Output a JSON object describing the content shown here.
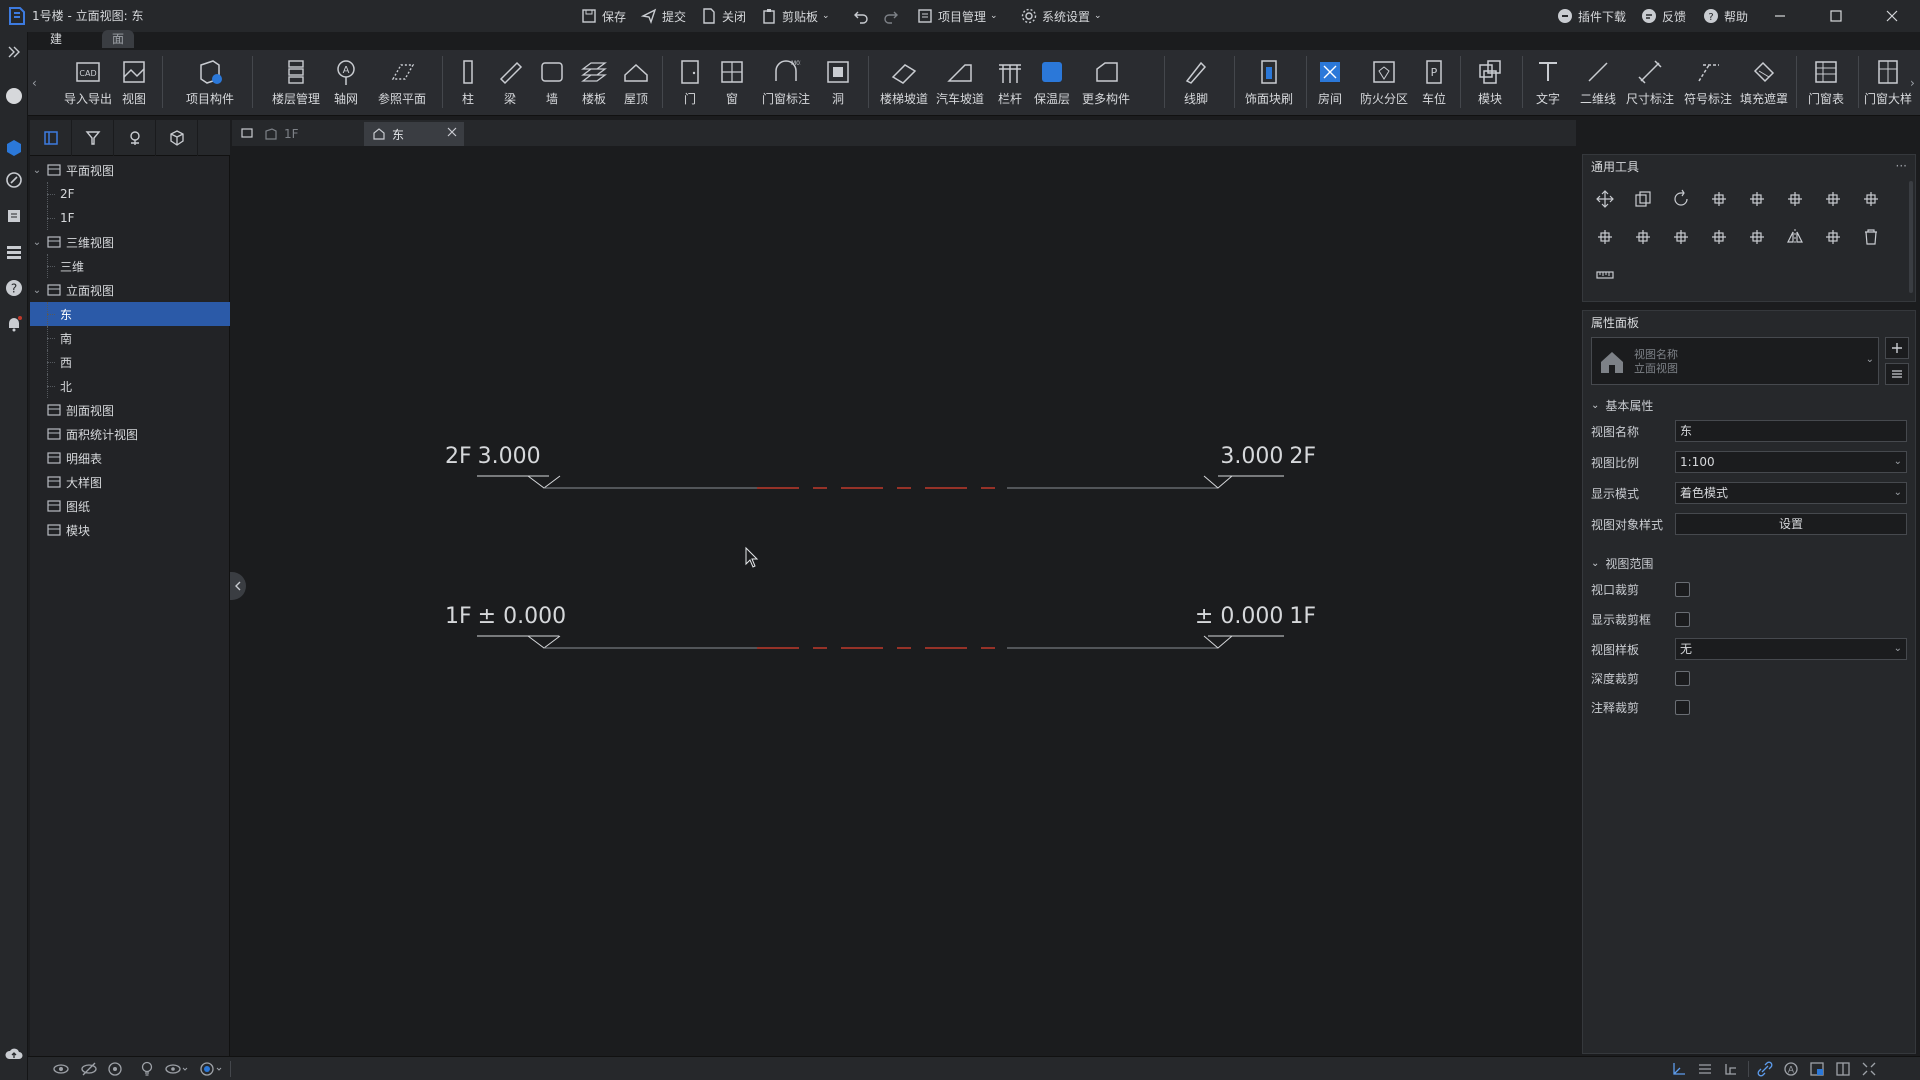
{
  "window": {
    "title": "1号楼 - 立面视图: 东",
    "toolbar": {
      "save": "保存",
      "submit": "提交",
      "close": "关闭",
      "clipboard": "剪贴板",
      "project_manage": "项目管理",
      "system_settings": "系统设置",
      "plugin_download": "插件下载",
      "feedback": "反馈",
      "help": "帮助"
    }
  },
  "ribbon": {
    "tabs": [
      "建筑",
      "面积统计"
    ],
    "buttons": [
      "导入导出",
      "视图",
      "项目构件",
      "楼层管理",
      "轴网",
      "参照平面",
      "柱",
      "梁",
      "墙",
      "楼板",
      "屋顶",
      "门",
      "窗",
      "门窗标注",
      "洞",
      "楼梯坡道",
      "汽车坡道",
      "栏杆",
      "保温层",
      "更多构件",
      "线脚",
      "饰面块刷",
      "房间",
      "防火分区",
      "车位",
      "模块",
      "文字",
      "二维线",
      "尺寸标注",
      "符号标注",
      "填充遮罩",
      "门窗表",
      "门窗大样"
    ]
  },
  "tree": {
    "nodes": [
      {
        "label": "平面视图",
        "level": 0,
        "expanded": true
      },
      {
        "label": "2F",
        "level": 1
      },
      {
        "label": "1F",
        "level": 1
      },
      {
        "label": "三维视图",
        "level": 0,
        "expanded": true
      },
      {
        "label": "三维",
        "level": 1
      },
      {
        "label": "立面视图",
        "level": 0,
        "expanded": true
      },
      {
        "label": "东",
        "level": 1,
        "selected": true
      },
      {
        "label": "南",
        "level": 1
      },
      {
        "label": "西",
        "level": 1
      },
      {
        "label": "北",
        "level": 1
      },
      {
        "label": "剖面视图",
        "level": 0
      },
      {
        "label": "面积统计视图",
        "level": 0
      },
      {
        "label": "明细表",
        "level": 0
      },
      {
        "label": "大样图",
        "level": 0
      },
      {
        "label": "图纸",
        "level": 0
      },
      {
        "label": "模块",
        "level": 0
      }
    ]
  },
  "view_tabs": [
    {
      "label": "1F",
      "active": false
    },
    {
      "label": "东",
      "active": true
    }
  ],
  "canvas": {
    "levels": [
      {
        "name": "2F",
        "elevation": "3.000"
      },
      {
        "name": "1F",
        "elevation": "± 0.000"
      }
    ]
  },
  "tools_panel": {
    "title": "通用工具"
  },
  "properties": {
    "title": "属性面板",
    "type_selector": {
      "line1": "视图名称",
      "line2": "立面视图"
    },
    "basic_section": "基本属性",
    "view_name_label": "视图名称",
    "view_name_value": "东",
    "scale_label": "视图比例",
    "scale_value": "1:100",
    "display_mode_label": "显示模式",
    "display_mode_value": "着色模式",
    "object_style_label": "视图对象样式",
    "object_style_button": "设置",
    "range_section": "视图范围",
    "crop_view_label": "视口裁剪",
    "show_crop_label": "显示裁剪框",
    "template_label": "视图样板",
    "template_value": "无",
    "depth_crop_label": "深度裁剪",
    "annotation_crop_label": "注释裁剪"
  },
  "colors": {
    "accent": "#2b5aa8",
    "level_red": "#c0392b",
    "bg": "#1b1c1e"
  }
}
